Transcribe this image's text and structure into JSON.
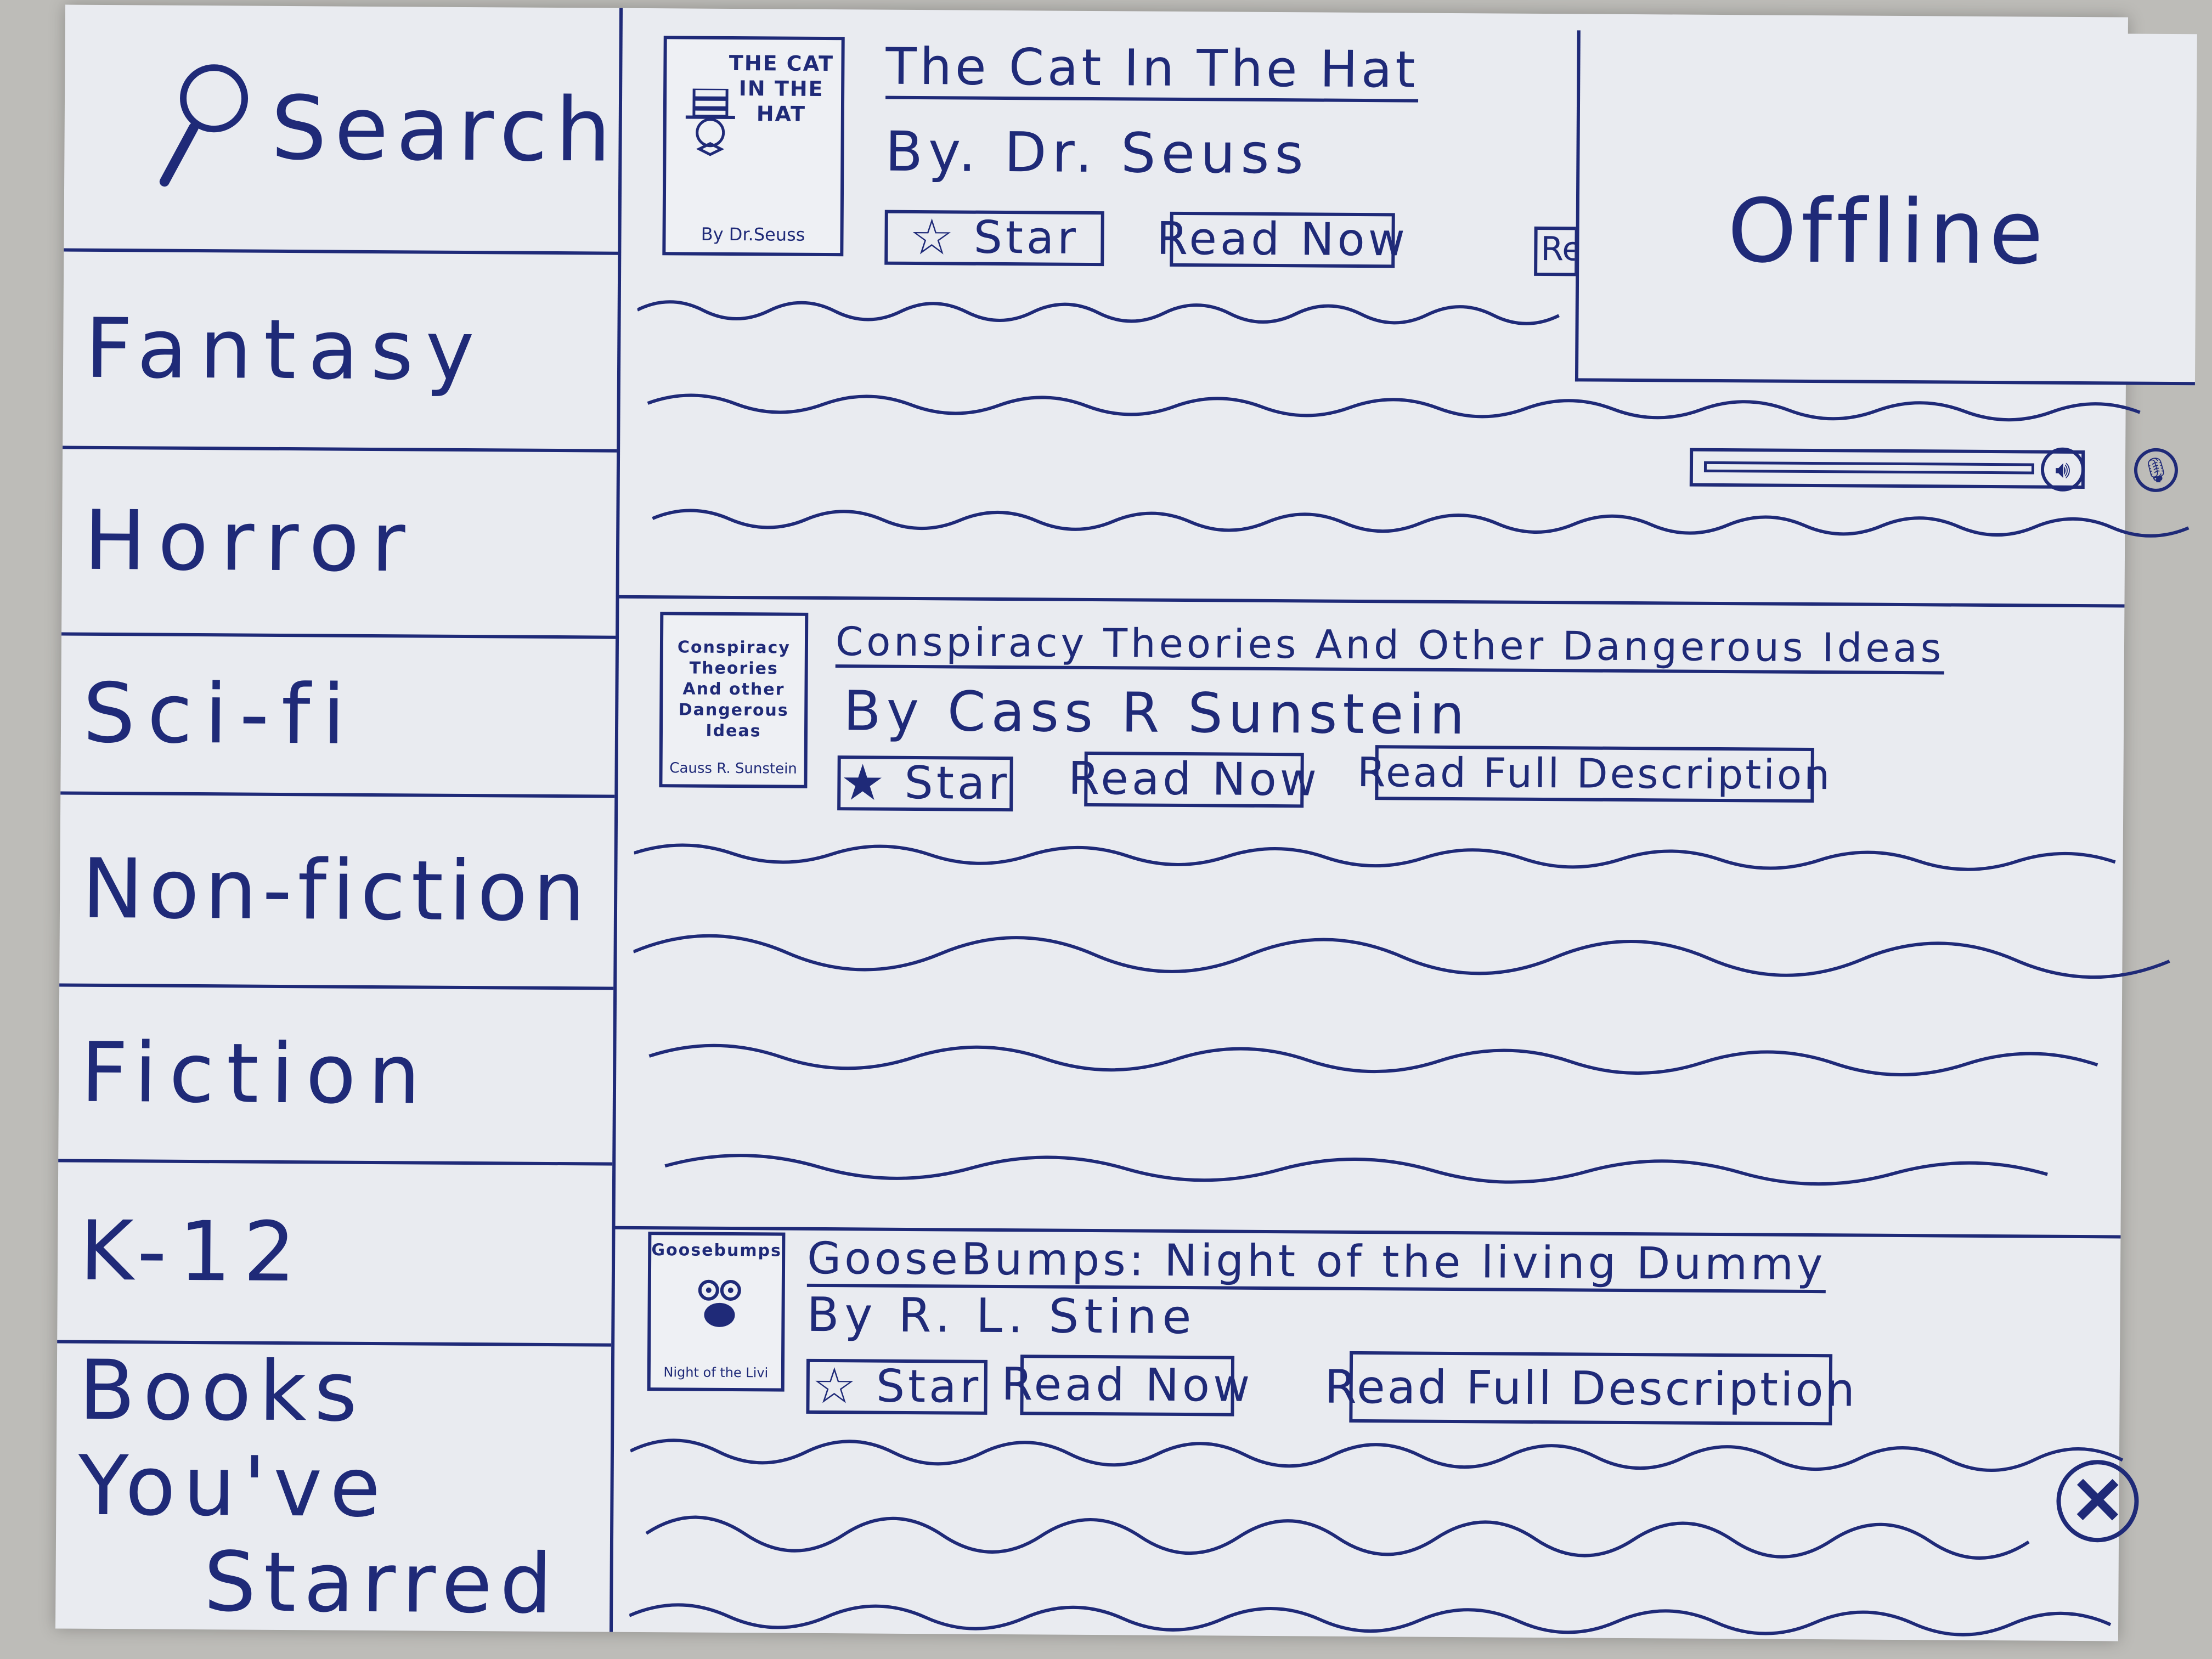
{
  "colors": {
    "ink": "#1f2a78",
    "paper": "#e9ebf0",
    "background": "#bdbcb8"
  },
  "sidebar": {
    "search_label": "Search",
    "search_icon": "magnifier-icon",
    "items": [
      {
        "label": "Fantasy"
      },
      {
        "label": "Horror"
      },
      {
        "label": "Sci-fi"
      },
      {
        "label": "Non-fiction"
      },
      {
        "label": "Fiction"
      },
      {
        "label": "K-12"
      }
    ],
    "starred": {
      "line1": "Books You've",
      "line2": "Starred"
    }
  },
  "books": [
    {
      "title": "The Cat In The Hat",
      "author": "By. Dr. Seuss",
      "cover": {
        "title": "THE CAT IN THE HAT",
        "author": "By Dr.Seuss"
      },
      "star_label": "Star",
      "starred": false,
      "read_now_label": "Read Now",
      "read_desc_peek": "Re"
    },
    {
      "title": "Conspiracy Theories And Other Dangerous Ideas",
      "author": "By Cass R Sunstein",
      "cover": {
        "title": "Conspiracy Theories And other Dangerous Ideas",
        "author": "Causs R. Sunstein"
      },
      "star_label": "Star",
      "starred": true,
      "read_now_label": "Read Now",
      "read_desc_label": "Read Full Description"
    },
    {
      "title": "GooseBumps: Night of the living Dummy",
      "author": "By R. L. Stine",
      "cover": {
        "title": "Goosebumps",
        "author": "Night of the Livi"
      },
      "star_label": "Star",
      "starred": false,
      "read_now_label": "Read Now",
      "read_desc_label": "Read Full Description"
    }
  ],
  "offline_popup": {
    "label": "Offline"
  },
  "audio": {
    "speaker_icon": "speaker-icon",
    "mic_icon": "microphone-icon",
    "volume": 0.85
  },
  "close_icon": "close-icon"
}
